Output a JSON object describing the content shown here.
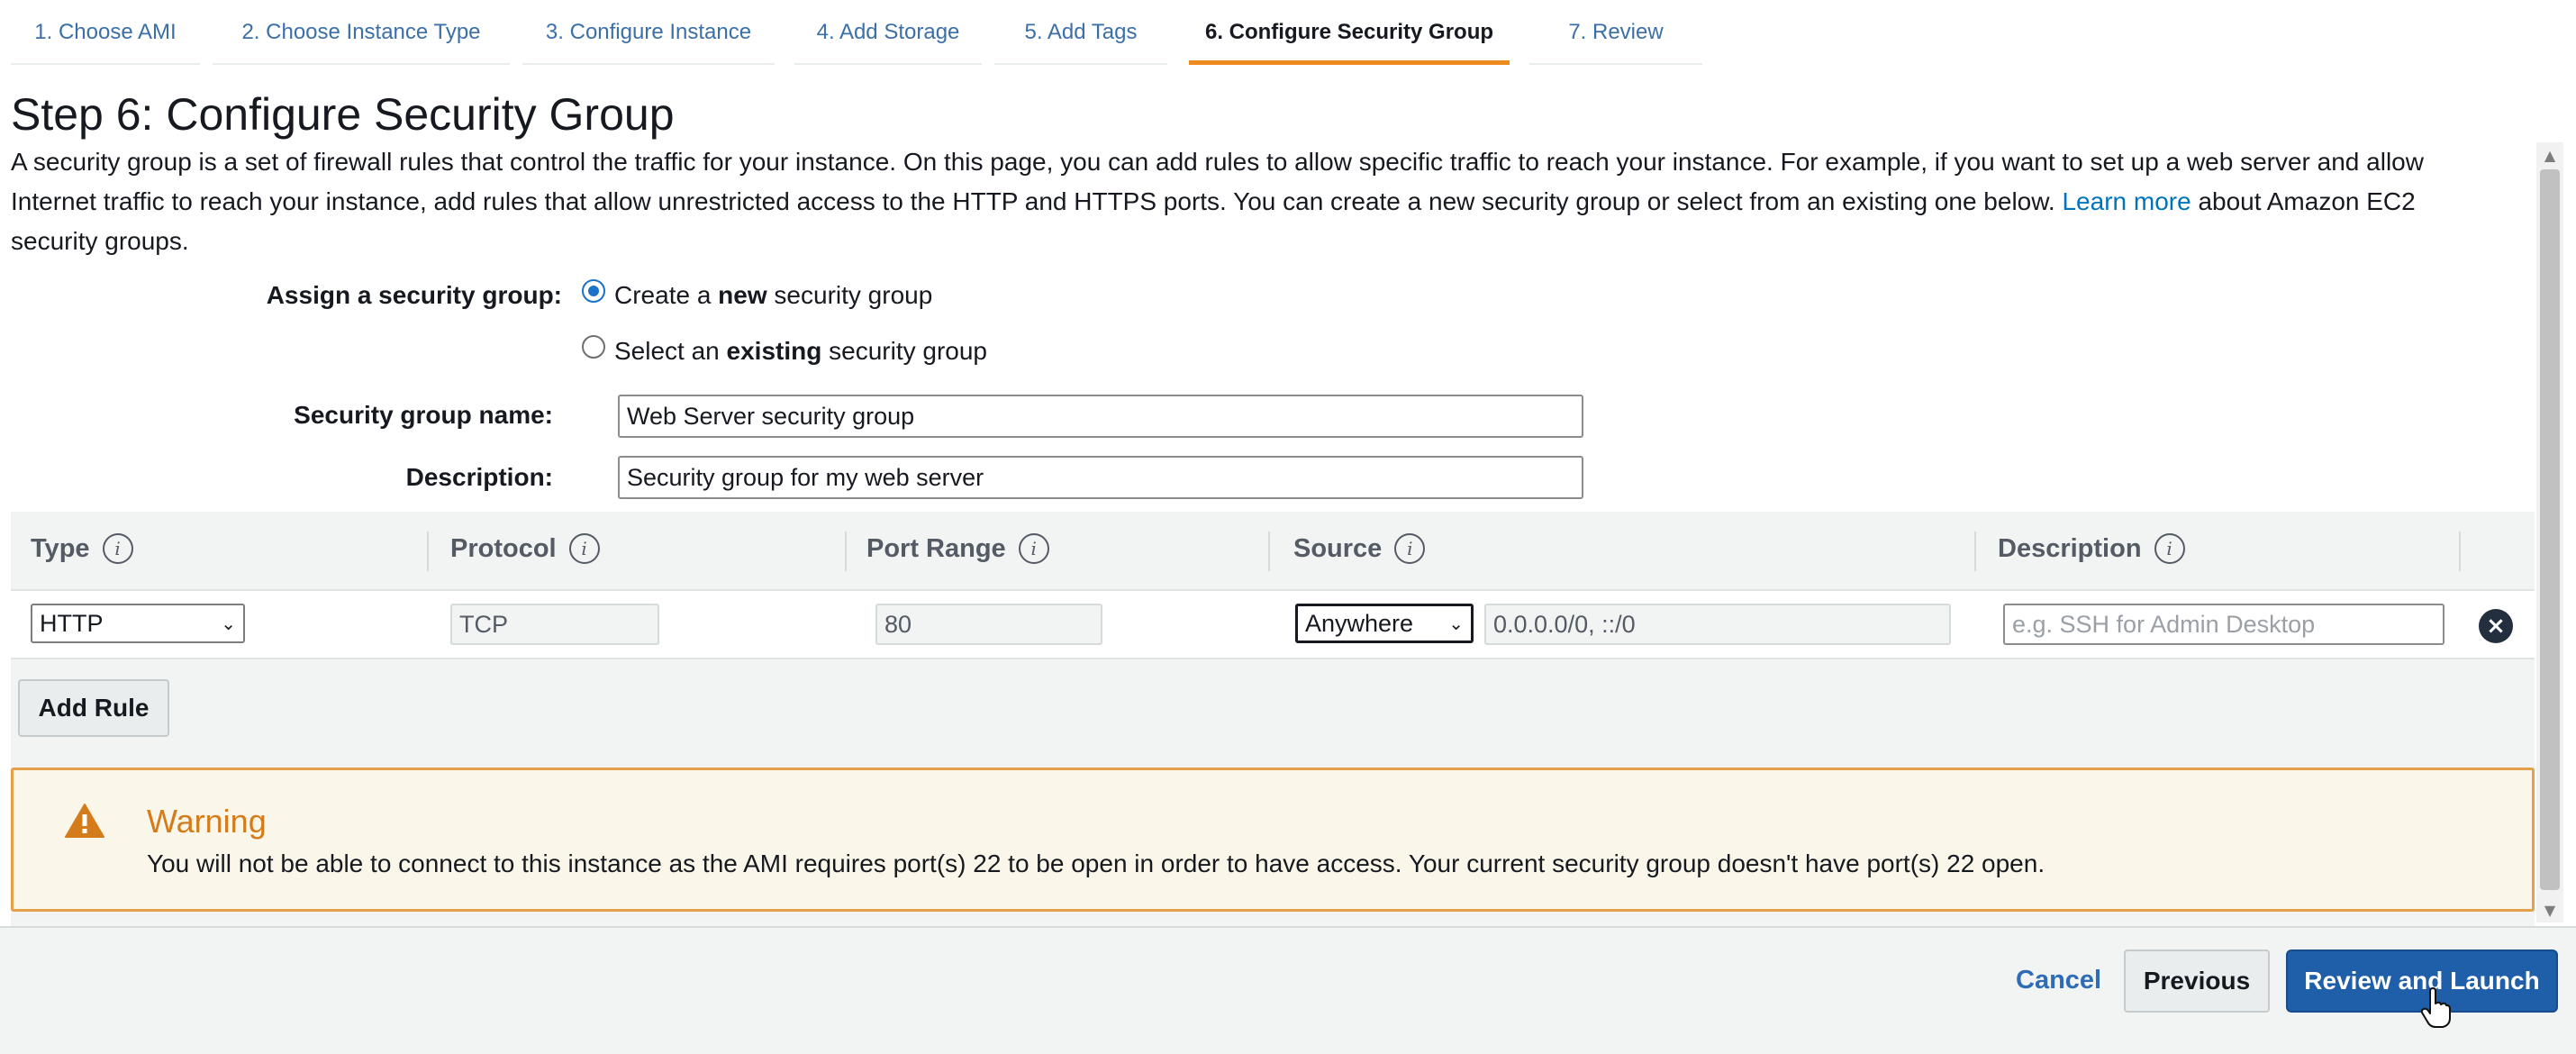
{
  "tabs": [
    {
      "label": "1. Choose AMI",
      "active": false
    },
    {
      "label": "2. Choose Instance Type",
      "active": false
    },
    {
      "label": "3. Configure Instance",
      "active": false
    },
    {
      "label": "4. Add Storage",
      "active": false
    },
    {
      "label": "5. Add Tags",
      "active": false
    },
    {
      "label": "6. Configure Security Group",
      "active": true
    },
    {
      "label": "7. Review",
      "active": false
    }
  ],
  "page": {
    "title": "Step 6: Configure Security Group",
    "intro": "A security group is a set of firewall rules that control the traffic for your instance. On this page, you can add rules to allow specific traffic to reach your instance. For example, if you want to set up a web server and allow Internet traffic to reach your instance, add rules that allow unrestricted access to the HTTP and HTTPS ports. You can create a new security group or select from an existing one below.",
    "learn_more": "Learn more",
    "intro_tail": "about Amazon EC2 security groups."
  },
  "assign": {
    "label": "Assign a security group:",
    "option_new": {
      "prefix": "Create a ",
      "bold": "new",
      "suffix": " security group",
      "selected": true
    },
    "option_existing": {
      "prefix": "Select an ",
      "bold": "existing",
      "suffix": " security group",
      "selected": false
    }
  },
  "form": {
    "name_label": "Security group name:",
    "name_value": "Web Server security group",
    "description_label": "Description:",
    "description_value": "Security group for my web server"
  },
  "rules": {
    "columns": [
      "Type",
      "Protocol",
      "Port Range",
      "Source",
      "Description"
    ],
    "info_glyph": "i",
    "rows": [
      {
        "type": "HTTP",
        "protocol": "TCP",
        "port_range": "80",
        "source_select": "Anywhere",
        "source_cidr": "0.0.0.0/0, ::/0",
        "description_placeholder": "e.g. SSH for Admin Desktop",
        "remove_icon": "×"
      }
    ],
    "add_rule": "Add Rule"
  },
  "warning": {
    "title": "Warning",
    "text": "You will not be able to connect to this instance as the AMI requires port(s) 22 to be open in order to have access. Your current security group doesn't have port(s) 22 open.",
    "icon": "warning-triangle-icon"
  },
  "footer": {
    "cancel": "Cancel",
    "previous": "Previous",
    "review_launch": "Review and Launch"
  },
  "colors": {
    "accent_tab": "#ec8a1e",
    "link": "#0073bb",
    "primary_button": "#1f5ea8",
    "warning_border": "#e5a04a",
    "warning_title": "#d47c1b"
  }
}
